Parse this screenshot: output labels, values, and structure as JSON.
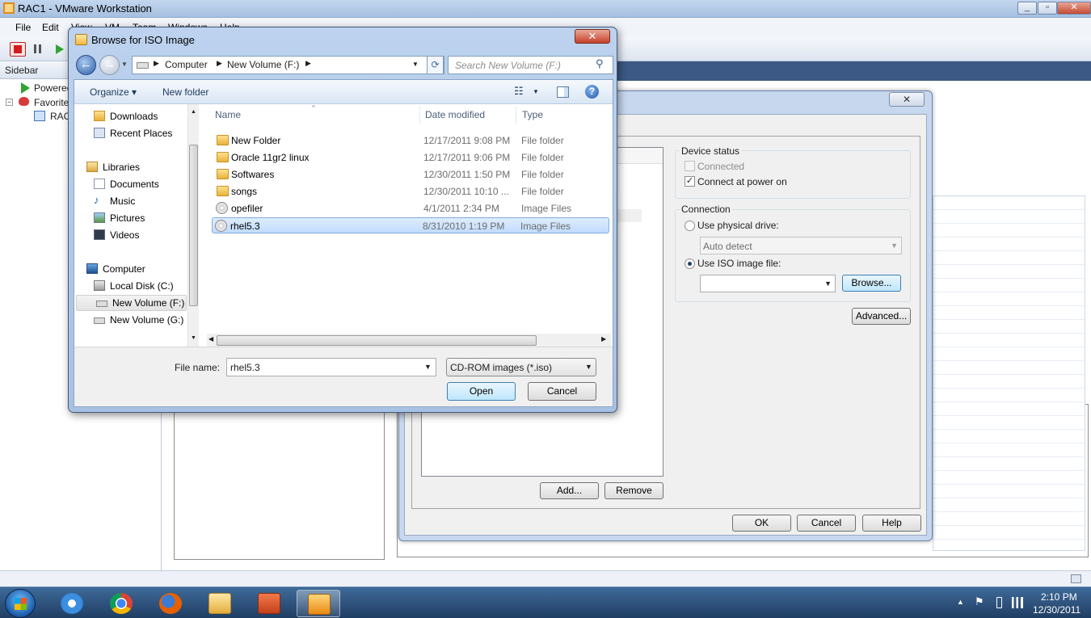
{
  "vmware": {
    "title": "RAC1 - VMware Workstation",
    "menu": [
      "File",
      "Edit",
      "View",
      "VM",
      "Team",
      "Windows",
      "Help"
    ],
    "sidebar": {
      "header": "Sidebar",
      "items": [
        "Powered",
        "Favorite",
        "RAC"
      ]
    }
  },
  "settings": {
    "device_status_title": "Device status",
    "connected_label": "Connected",
    "connect_power_label": "Connect at power on",
    "connection_title": "Connection",
    "physical_drive_label": "Use physical drive:",
    "auto_detect": "Auto detect",
    "iso_label": "Use ISO image file:",
    "browse_label": "Browse...",
    "advanced_label": "Advanced...",
    "add_label": "Add...",
    "remove_label": "Remove",
    "ok_label": "OK",
    "cancel_label": "Cancel",
    "help_label": "Help",
    "close_glyph": "✕"
  },
  "browse": {
    "title": "Browse for ISO Image",
    "close_glyph": "✕",
    "breadcrumb": [
      "Computer",
      "New Volume (F:)"
    ],
    "search_placeholder": "Search New Volume (F:)",
    "organize_label": "Organize ▾",
    "new_folder_label": "New folder",
    "nav_items": [
      {
        "label": "Downloads",
        "icon": "folder-icon"
      },
      {
        "label": "Recent Places",
        "icon": "recent-icon"
      },
      {
        "label": "Libraries",
        "icon": "library-icon"
      },
      {
        "label": "Documents",
        "icon": "documents-icon"
      },
      {
        "label": "Music",
        "icon": "music-icon"
      },
      {
        "label": "Pictures",
        "icon": "pictures-icon"
      },
      {
        "label": "Videos",
        "icon": "videos-icon"
      },
      {
        "label": "Computer",
        "icon": "computer-icon"
      },
      {
        "label": "Local Disk (C:)",
        "icon": "disk-icon"
      },
      {
        "label": "New Volume (F:)",
        "icon": "drive-icon"
      },
      {
        "label": "New Volume (G:)",
        "icon": "drive-icon"
      }
    ],
    "columns": {
      "name": "Name",
      "date": "Date modified",
      "type": "Type"
    },
    "files": [
      {
        "name": "New Folder",
        "date": "12/17/2011 9:08 PM",
        "type": "File folder",
        "icon": "folder-icon"
      },
      {
        "name": "Oracle 11gr2 linux",
        "date": "12/17/2011 9:06 PM",
        "type": "File folder",
        "icon": "folder-icon"
      },
      {
        "name": "Softwares",
        "date": "12/30/2011 1:50 PM",
        "type": "File folder",
        "icon": "folder-icon"
      },
      {
        "name": "songs",
        "date": "12/30/2011 10:10 ...",
        "type": "File folder",
        "icon": "folder-icon"
      },
      {
        "name": "opefiler",
        "date": "4/1/2011 2:34 PM",
        "type": "Image Files",
        "icon": "disc-image-icon"
      },
      {
        "name": "rhel5.3",
        "date": "8/31/2010 1:19 PM",
        "type": "Image Files",
        "icon": "disc-image-icon"
      }
    ],
    "file_name_label": "File name:",
    "file_name_value": "rhel5.3",
    "file_type": "CD-ROM images (*.iso)",
    "open_label": "Open",
    "cancel_label": "Cancel"
  },
  "taskbar": {
    "time": "2:10 PM",
    "date": "12/30/2011"
  }
}
